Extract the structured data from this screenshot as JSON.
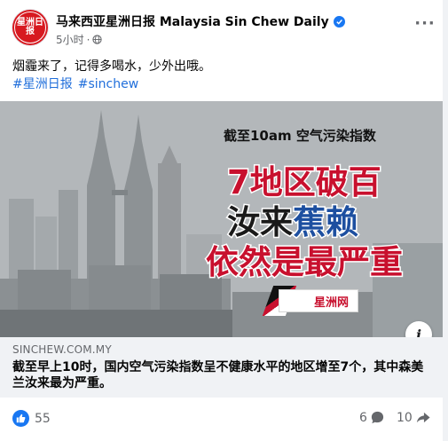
{
  "header": {
    "page_name": "马来西亚星洲日报 Malaysia Sin Chew Daily",
    "timestamp": "5小时",
    "separator": "·",
    "avatar_text": "星洲日报"
  },
  "post": {
    "text": "烟霾来了，记得多喝水，少外出哦。",
    "hashtags": [
      "#星洲日报",
      "#sinchew"
    ]
  },
  "image": {
    "subtitle": "截至10am  空气污染指数",
    "line1": "7地区破百",
    "line2_a": "汝来",
    "line2_b": "蕉赖",
    "line3": "依然是最严重",
    "logo_text": "星洲网"
  },
  "link_preview": {
    "domain": "SINCHEW.COM.MY",
    "title": "截至早上10时，国内空气污染指数呈不健康水平的地区增至7个，其中森美兰汝来最为严重。"
  },
  "footer": {
    "likes": "55",
    "comments": "6",
    "shares": "10"
  },
  "colors": {
    "link_blue": "#216fdb",
    "facebook_blue": "#1877f2",
    "headline_red": "#c8102e",
    "headline_blue": "#1d4fa0"
  },
  "icons": {
    "verified": "verified-badge-icon",
    "globe": "globe-icon",
    "like": "like-icon",
    "comment": "comment-icon",
    "share": "share-icon",
    "info": "info-icon"
  }
}
